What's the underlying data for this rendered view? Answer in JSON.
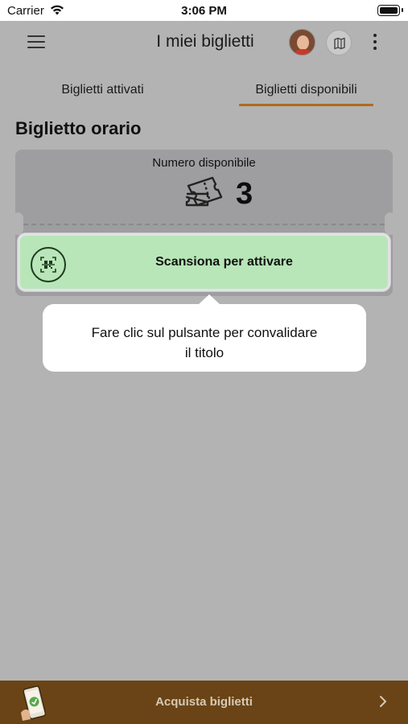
{
  "status_bar": {
    "carrier": "Carrier",
    "time": "3:06 PM"
  },
  "app_bar": {
    "title": "I miei biglietti"
  },
  "tabs": [
    {
      "label": "Biglietti attivati",
      "selected": false
    },
    {
      "label": "Biglietti disponibili",
      "selected": true
    }
  ],
  "section": {
    "title": "Biglietto orario"
  },
  "ticket_card": {
    "count_label": "Numero disponibile",
    "count_value": "3",
    "scan_button_label": "Scansiona per attivare"
  },
  "tooltip": {
    "line1": "Fare clic sul pulsante per convalidare",
    "line2": "il titolo"
  },
  "bottom_bar": {
    "label": "Acquista biglietti"
  },
  "colors": {
    "accent": "#b06a1e",
    "scan_button": "#b8e6b8",
    "bottom_bar": "#6a4416",
    "overlay": "#b3b3b3"
  },
  "icons": [
    "wifi-icon",
    "battery-icon",
    "menu-icon",
    "avatar",
    "map-icon",
    "more-icon",
    "ticket-icon",
    "qr-scan-icon",
    "phone-ticket-icon",
    "chevron-right-icon"
  ]
}
